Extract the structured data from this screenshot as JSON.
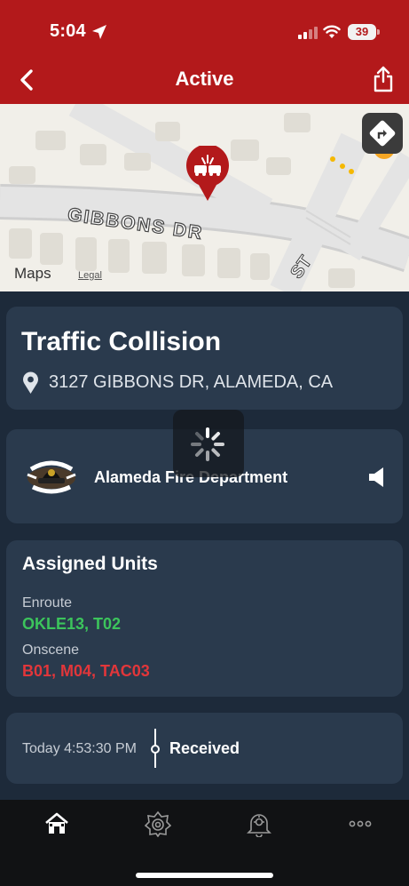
{
  "status_bar": {
    "time": "5:04",
    "battery": "39"
  },
  "nav": {
    "title": "Active"
  },
  "map": {
    "street": "GIBBONS DR",
    "street2": "ST",
    "brand": "Maps",
    "legal": "Legal"
  },
  "incident": {
    "type": "Traffic Collision",
    "address": "3127 GIBBONS DR, ALAMEDA, CA"
  },
  "department": {
    "name": "Alameda Fire Department"
  },
  "units": {
    "title": "Assigned Units",
    "enroute_label": "Enroute",
    "enroute_units": "OKLE13, T02",
    "onscene_label": "Onscene",
    "onscene_units": "B01, M04, TAC03"
  },
  "timeline": {
    "time": "Today 4:53:30 PM",
    "status": "Received"
  },
  "colors": {
    "header": "#b3191b",
    "enroute": "#3cc45c",
    "onscene": "#e2363a",
    "card": "#2a3a4d"
  },
  "icons": [
    "location-arrow-icon",
    "signal-icon",
    "wifi-icon",
    "back-chevron-icon",
    "share-icon",
    "directions-icon",
    "incident-pin-icon",
    "location-pin-icon",
    "speaker-icon",
    "loading-spinner-icon",
    "home-icon",
    "fire-badge-icon",
    "alert-bell-icon",
    "more-icon"
  ]
}
